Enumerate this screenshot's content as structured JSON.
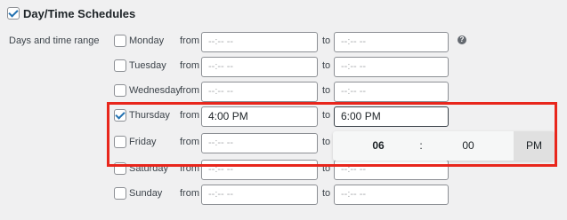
{
  "header": {
    "title": "Day/Time Schedules",
    "checked": true
  },
  "section_label": "Days and time range",
  "from_label": "from",
  "to_label": "to",
  "days": [
    {
      "name": "Monday",
      "checked": false,
      "from": "--:-- --",
      "to": "--:-- --"
    },
    {
      "name": "Tuesday",
      "checked": false,
      "from": "--:-- --",
      "to": "--:-- --"
    },
    {
      "name": "Wednesday",
      "checked": false,
      "from": "--:-- --",
      "to": "--:-- --"
    },
    {
      "name": "Thursday",
      "checked": true,
      "from": "4:00 PM",
      "to": "6:00 PM"
    },
    {
      "name": "Friday",
      "checked": false,
      "from": "--:-- --",
      "to": ""
    },
    {
      "name": "Saturday",
      "checked": false,
      "from": "--:-- --",
      "to": "--:-- --"
    },
    {
      "name": "Sunday",
      "checked": false,
      "from": "--:-- --",
      "to": "--:-- --"
    }
  ],
  "help_icon": "question-circle-icon",
  "time_picker": {
    "hour": "06",
    "separator": ":",
    "minute": "00",
    "period": "PM"
  },
  "colors": {
    "highlight": "#e8261c",
    "check": "#2271b1"
  }
}
